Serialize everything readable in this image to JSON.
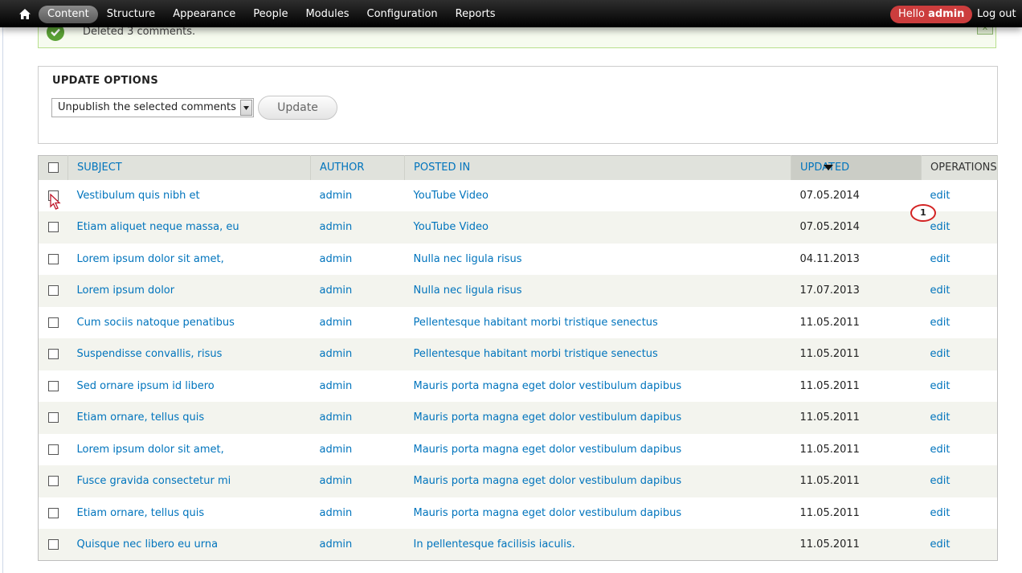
{
  "toolbar": {
    "home_icon": "home-icon",
    "nav": [
      {
        "label": "Content",
        "active": true
      },
      {
        "label": "Structure"
      },
      {
        "label": "Appearance"
      },
      {
        "label": "People"
      },
      {
        "label": "Modules"
      },
      {
        "label": "Configuration"
      },
      {
        "label": "Reports"
      }
    ],
    "hello_prefix": "Hello",
    "username": "admin",
    "logout": "Log out",
    "hello_color": "#cc3d3d"
  },
  "message": {
    "text": "Deleted 3 comments.",
    "close": "x"
  },
  "update_options": {
    "legend": "UPDATE OPTIONS",
    "selected": "Unpublish the selected comments",
    "button": "Update"
  },
  "table": {
    "headers": {
      "subject": "SUBJECT",
      "author": "AUTHOR",
      "posted_in": "POSTED IN",
      "updated": "UPDATED",
      "operations": "OPERATIONS"
    },
    "rows": [
      {
        "subject": "Vestibulum quis nibh et",
        "author": "admin",
        "posted_in": "YouTube Video",
        "updated": "07.05.2014",
        "op": "edit"
      },
      {
        "subject": "Etiam aliquet neque massa, eu",
        "author": "admin",
        "posted_in": "YouTube Video",
        "updated": "07.05.2014",
        "op": "edit"
      },
      {
        "subject": "Lorem ipsum dolor sit amet,",
        "author": "admin",
        "posted_in": "Nulla nec ligula risus",
        "updated": "04.11.2013",
        "op": "edit"
      },
      {
        "subject": "Lorem ipsum dolor",
        "author": "admin",
        "posted_in": "Nulla nec ligula risus",
        "updated": "17.07.2013",
        "op": "edit"
      },
      {
        "subject": "Cum sociis natoque penatibus",
        "author": "admin",
        "posted_in": "Pellentesque habitant morbi tristique senectus",
        "updated": "11.05.2011",
        "op": "edit"
      },
      {
        "subject": "Suspendisse convallis, risus",
        "author": "admin",
        "posted_in": "Pellentesque habitant morbi tristique senectus",
        "updated": "11.05.2011",
        "op": "edit"
      },
      {
        "subject": "Sed ornare ipsum id libero",
        "author": "admin",
        "posted_in": "Mauris porta magna eget dolor vestibulum dapibus",
        "updated": "11.05.2011",
        "op": "edit"
      },
      {
        "subject": "Etiam ornare, tellus quis",
        "author": "admin",
        "posted_in": "Mauris porta magna eget dolor vestibulum dapibus",
        "updated": "11.05.2011",
        "op": "edit"
      },
      {
        "subject": "Lorem ipsum dolor sit amet,",
        "author": "admin",
        "posted_in": "Mauris porta magna eget dolor vestibulum dapibus",
        "updated": "11.05.2011",
        "op": "edit"
      },
      {
        "subject": "Fusce gravida consectetur mi",
        "author": "admin",
        "posted_in": "Mauris porta magna eget dolor vestibulum dapibus",
        "updated": "11.05.2011",
        "op": "edit"
      },
      {
        "subject": "Etiam ornare, tellus quis",
        "author": "admin",
        "posted_in": "Mauris porta magna eget dolor vestibulum dapibus",
        "updated": "11.05.2011",
        "op": "edit"
      },
      {
        "subject": "Quisque nec libero eu urna",
        "author": "admin",
        "posted_in": "In pellentesque facilisis iaculis.",
        "updated": "11.05.2011",
        "op": "edit"
      }
    ]
  },
  "callout": "1",
  "colors": {
    "link": "#0074bd",
    "success_border": "#b7df8d",
    "callout_border": "#d32222"
  }
}
